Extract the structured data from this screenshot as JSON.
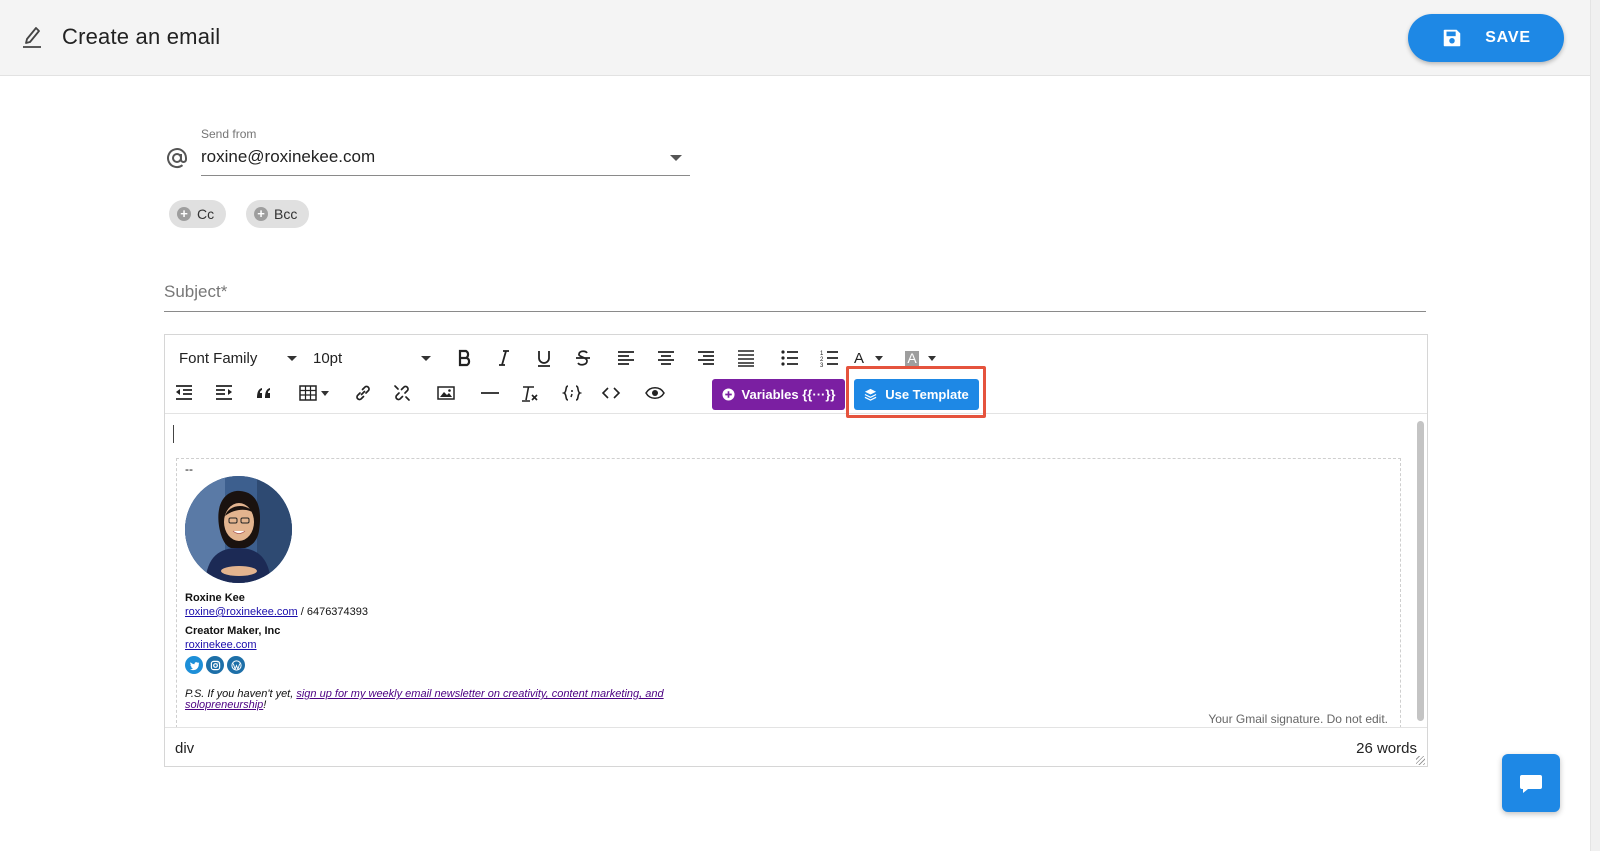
{
  "header": {
    "title": "Create an email",
    "save_label": "SAVE"
  },
  "form": {
    "send_from_label": "Send from",
    "send_from_value": "roxine@roxinekee.com",
    "cc_label": "Cc",
    "bcc_label": "Bcc",
    "subject_placeholder": "Subject*",
    "subject_value": ""
  },
  "toolbar": {
    "font_family": "Font Family",
    "font_size": "10pt",
    "text_color_letter": "A",
    "bg_color_letter": "A",
    "variables_label": "Variables {{···}}",
    "use_template_label": "Use Template"
  },
  "signature": {
    "dash": "--",
    "name": "Roxine Kee",
    "email": "roxine@roxinekee.com",
    "phone_sep": " / 6476374393",
    "company": "Creator Maker, Inc",
    "website": "roxinekee.com",
    "ps_prefix": "P.S. If you haven't yet, ",
    "ps_link": "sign up for my weekly email newsletter on creativity, content marketing, and solopreneurship",
    "ps_suffix": "!",
    "note": "Your Gmail signature. Do not edit."
  },
  "statusbar": {
    "path": "div",
    "word_count": "26 words"
  },
  "colors": {
    "accent": "#1e88e5",
    "variables": "#7b1fa2",
    "highlight_outline": "#e5533d"
  }
}
